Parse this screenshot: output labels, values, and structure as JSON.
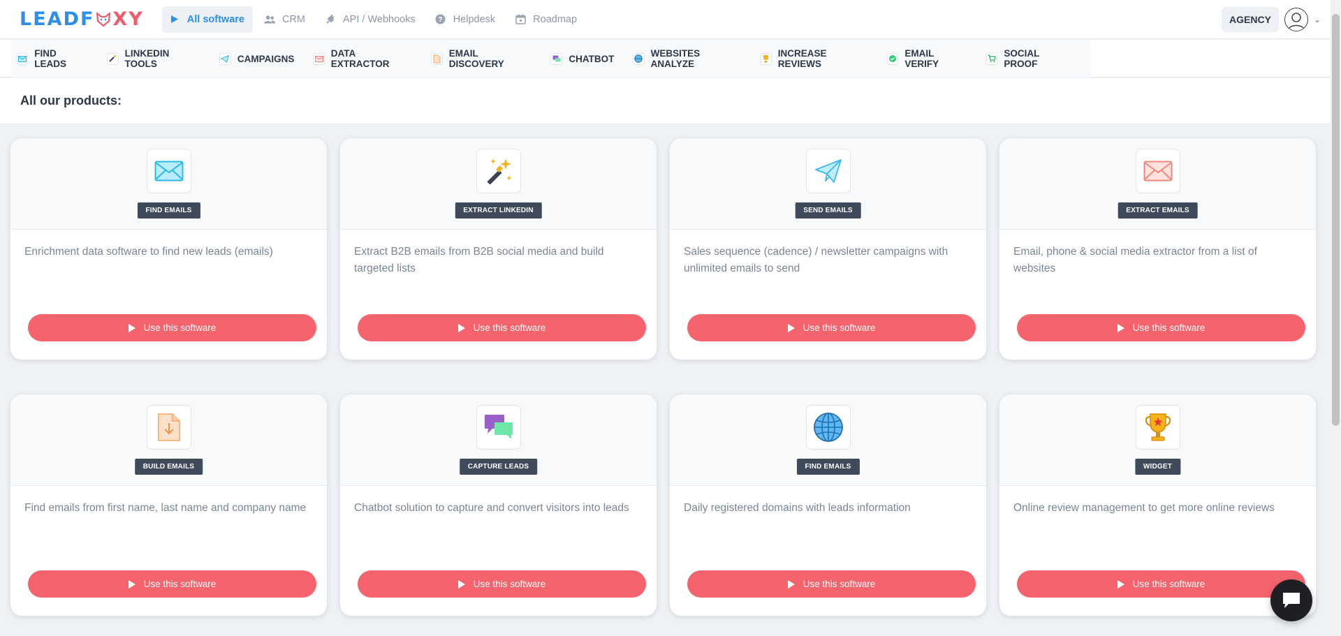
{
  "brand": {
    "logo_part1": "LEADF",
    "logo_part2": "XY"
  },
  "topnav": [
    {
      "label": "All software",
      "icon": "play-icon"
    },
    {
      "label": "CRM",
      "icon": "users-icon"
    },
    {
      "label": "API / Webhooks",
      "icon": "plug-icon"
    },
    {
      "label": "Helpdesk",
      "icon": "question-icon"
    },
    {
      "label": "Roadmap",
      "icon": "calendar-icon"
    }
  ],
  "account": {
    "plan_label": "AGENCY"
  },
  "products_bar": [
    {
      "label": "FIND LEADS",
      "icon": "email-icon",
      "color": "#3ec1f3"
    },
    {
      "label": "LINKEDIN TOOLS",
      "icon": "magic-wand-icon",
      "color": "#f2a900"
    },
    {
      "label": "CAMPAIGNS",
      "icon": "paper-plane-icon",
      "color": "#4fb8f0"
    },
    {
      "label": "DATA EXTRACTOR",
      "icon": "envelope-red-icon",
      "color": "#f16f67"
    },
    {
      "label": "EMAIL DISCOVERY",
      "icon": "file-icon",
      "color": "#f9a35b"
    },
    {
      "label": "CHATBOT",
      "icon": "chat-icon",
      "color": "#9b59b6"
    },
    {
      "label": "WEBSITES ANALYZE",
      "icon": "globe-icon",
      "color": "#3fa9e8"
    },
    {
      "label": "INCREASE REVIEWS",
      "icon": "trophy-icon",
      "color": "#f3b21e"
    },
    {
      "label": "EMAIL VERIFY",
      "icon": "check-badge-icon",
      "color": "#2ecc71"
    },
    {
      "label": "SOCIAL PROOF",
      "icon": "cart-icon",
      "color": "#27ae60"
    }
  ],
  "section_title": "All our products:",
  "cards": [
    {
      "badge": "FIND EMAILS",
      "icon": "email-icon",
      "description": "Enrichment data software to find new leads (emails)",
      "button": "Use this software"
    },
    {
      "badge": "EXTRACT LINKEDIN",
      "icon": "magic-wand-icon",
      "description": "Extract B2B emails from B2B social media and build targeted lists",
      "button": "Use this software"
    },
    {
      "badge": "SEND EMAILS",
      "icon": "paper-plane-icon",
      "description": "Sales sequence (cadence) / newsletter campaigns with unlimited emails to send",
      "button": "Use this software"
    },
    {
      "badge": "EXTRACT EMAILS",
      "icon": "envelope-red-icon",
      "description": "Email, phone & social media extractor from a list of websites",
      "button": "Use this software"
    },
    {
      "badge": "BUILD EMAILS",
      "icon": "file-download-icon",
      "description": "Find emails from first name, last name and company name",
      "button": "Use this software"
    },
    {
      "badge": "CAPTURE LEADS",
      "icon": "chat-bubbles-icon",
      "description": "Chatbot solution to capture and convert visitors into leads",
      "button": "Use this software"
    },
    {
      "badge": "FIND EMAILS",
      "icon": "globe-icon",
      "description": "Daily registered domains with leads information",
      "button": "Use this software"
    },
    {
      "badge": "WIDGET",
      "icon": "trophy-icon",
      "description": "Online review management to get more online reviews",
      "button": "Use this software"
    }
  ]
}
